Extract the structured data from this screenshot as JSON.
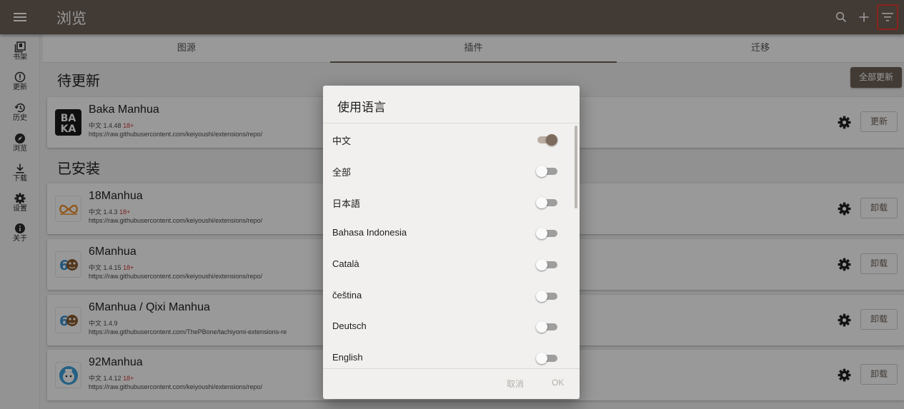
{
  "topbar": {
    "title": "浏览",
    "icons": [
      "menu-icon",
      "search-icon",
      "add-icon",
      "filter-icon"
    ],
    "bg_color": "#6e6158",
    "filter_highlight_color": "#e53c2e"
  },
  "rail": {
    "items": [
      {
        "label": "书架",
        "icon": "library-icon"
      },
      {
        "label": "更新",
        "icon": "alert-circle-icon"
      },
      {
        "label": "历史",
        "icon": "history-icon"
      },
      {
        "label": "浏览",
        "icon": "compass-icon"
      },
      {
        "label": "下载",
        "icon": "download-icon"
      },
      {
        "label": "设置",
        "icon": "gear-icon"
      },
      {
        "label": "关于",
        "icon": "info-icon"
      }
    ]
  },
  "tabs": {
    "items": [
      {
        "label": "图源"
      },
      {
        "label": "插件"
      },
      {
        "label": "迁移"
      }
    ],
    "selected": "插件"
  },
  "sections": {
    "pending_title": "待更新",
    "update_all_label": "全部更新",
    "installed_title": "已安装"
  },
  "pending": [
    {
      "name": "Baka Manhua",
      "lang": "中文",
      "version": "1.4.48",
      "nsfw": "18+",
      "url": "https://raw.githubusercontent.com/keiyoushi/extensions/repo/",
      "action": "更新"
    }
  ],
  "installed": [
    {
      "name": "18Manhua",
      "lang": "中文",
      "version": "1.4.3",
      "nsfw": "18+",
      "url": "https://raw.githubusercontent.com/keiyoushi/extensions/repo/",
      "action": "卸载"
    },
    {
      "name": "6Manhua",
      "lang": "中文",
      "version": "1.4.15",
      "nsfw": "18+",
      "url": "https://raw.githubusercontent.com/keiyoushi/extensions/repo/",
      "action": "卸载"
    },
    {
      "name": "6Manhua / Qixi Manhua",
      "lang": "中文",
      "version": "1.4.9",
      "nsfw": "",
      "url": "https://raw.githubusercontent.com/ThePBone/tachiyomi-extensions-re",
      "action": "卸载"
    },
    {
      "name": "92Manhua",
      "lang": "中文",
      "version": "1.4.12",
      "nsfw": "18+",
      "url": "https://raw.githubusercontent.com/keiyoushi/extensions/repo/",
      "action": "卸载"
    }
  ],
  "dialog": {
    "title": "使用语言",
    "languages": [
      {
        "label": "中文",
        "enabled": true
      },
      {
        "label": "全部",
        "enabled": false
      },
      {
        "label": "日本語",
        "enabled": false
      },
      {
        "label": "Bahasa Indonesia",
        "enabled": false
      },
      {
        "label": "Català",
        "enabled": false
      },
      {
        "label": "čeština",
        "enabled": false
      },
      {
        "label": "Deutsch",
        "enabled": false
      },
      {
        "label": "English",
        "enabled": false
      }
    ],
    "cancel_label": "取消",
    "ok_label": "OK"
  }
}
